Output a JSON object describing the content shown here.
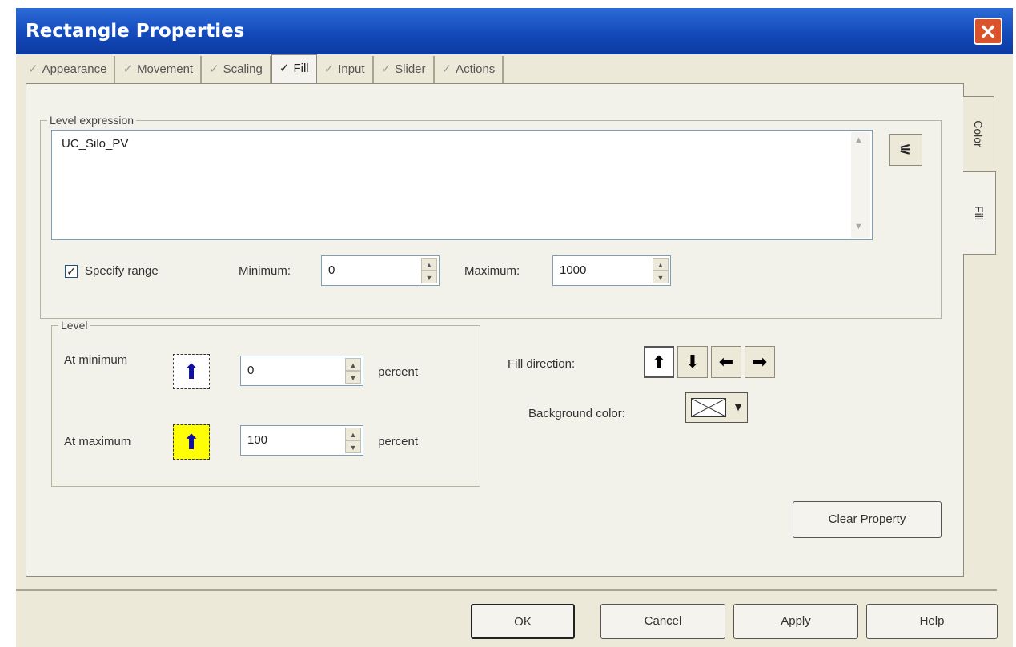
{
  "window": {
    "title": "Rectangle Properties"
  },
  "tabs": [
    {
      "label": "Appearance",
      "checked": false
    },
    {
      "label": "Movement",
      "checked": false
    },
    {
      "label": "Scaling",
      "checked": false
    },
    {
      "label": "Fill",
      "checked": true
    },
    {
      "label": "Input",
      "checked": false
    },
    {
      "label": "Slider",
      "checked": false
    },
    {
      "label": "Actions",
      "checked": false
    }
  ],
  "side_tabs": [
    "Color",
    "Fill"
  ],
  "level_expression": {
    "legend": "Level expression",
    "value": "UC_Silo_PV"
  },
  "range": {
    "specify_label": "Specify range",
    "specify_checked": true,
    "minimum_label": "Minimum:",
    "minimum_value": "0",
    "maximum_label": "Maximum:",
    "maximum_value": "1000"
  },
  "level": {
    "legend": "Level",
    "at_minimum_label": "At minimum",
    "at_minimum_value": "0",
    "at_minimum_unit": "percent",
    "at_maximum_label": "At maximum",
    "at_maximum_value": "100",
    "at_maximum_unit": "percent"
  },
  "fill_direction": {
    "label": "Fill direction:",
    "selected": "up",
    "icons": [
      "arrow-up-icon",
      "arrow-down-icon",
      "arrow-left-icon",
      "arrow-right-icon"
    ]
  },
  "background_color": {
    "label": "Background color:",
    "value": "#ffffff"
  },
  "colors": {
    "title_bar": "#1248b8",
    "fill_arrow": "#1010a0",
    "max_fill": "#ffff00"
  },
  "buttons": {
    "clear_property": "Clear Property",
    "ok": "OK",
    "cancel": "Cancel",
    "apply": "Apply",
    "help": "Help"
  }
}
